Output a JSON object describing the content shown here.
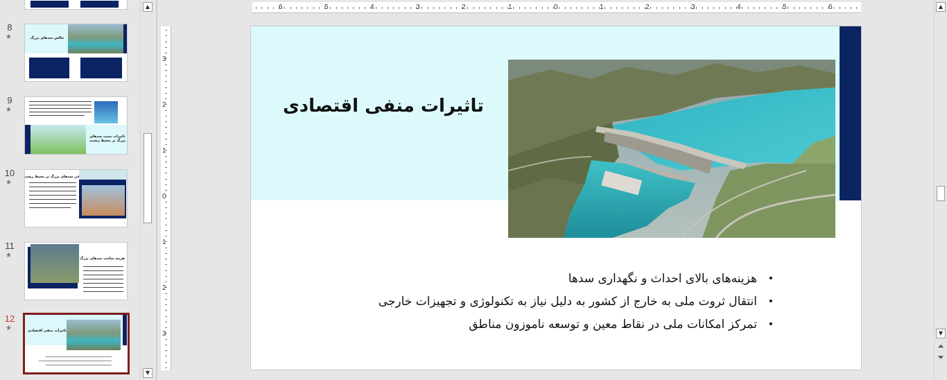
{
  "thumbnails": [
    {
      "number": "8",
      "star": "★",
      "title": "چالش سدهای بزرگ"
    },
    {
      "number": "9",
      "star": "★",
      "title": "تاثیرات مثبت سدهای بزرگ بر محیط زیست"
    },
    {
      "number": "10",
      "star": "★",
      "title": "تاثیرات منفی سدهای بزرگ بر محیط زیست"
    },
    {
      "number": "11",
      "star": "★",
      "title": "هزینه ساخت سدهای بزرگ"
    },
    {
      "number": "12",
      "star": "★",
      "title": "تاثیرات منفی اقتصادی",
      "selected": true
    }
  ],
  "ruler": {
    "horizontal_labels": [
      "6",
      "5",
      "4",
      "3",
      "2",
      "1",
      "0",
      "1",
      "2",
      "3",
      "4",
      "5",
      "6"
    ],
    "vertical_labels": [
      "3",
      "2",
      "1",
      "0",
      "1",
      "2",
      "3"
    ]
  },
  "slide": {
    "title": "تاثیرات منفی اقتصادی",
    "image_alt": "dam-photo",
    "bullets": [
      "هزینه‌های بالای احداث و نگهداری سدها",
      "انتقال ثروت ملی به خارج از کشور به دلیل نیاز به تکنولوژی و تجهیزات خارجی",
      "تمرکز امکانات ملی در نقاط معین و توسعه ناموزون مناطق"
    ],
    "bullet_symbol": "•"
  },
  "colors": {
    "cyan_band": "#dcfafc",
    "navy_bar": "#0a2562",
    "selected_thumb_border": "#7f1d1d",
    "selected_number": "#c0392b"
  },
  "icons": {
    "scroll_up": "▲",
    "scroll_down": "▼",
    "prev_slide": "⏶",
    "next_slide": "⏷"
  }
}
